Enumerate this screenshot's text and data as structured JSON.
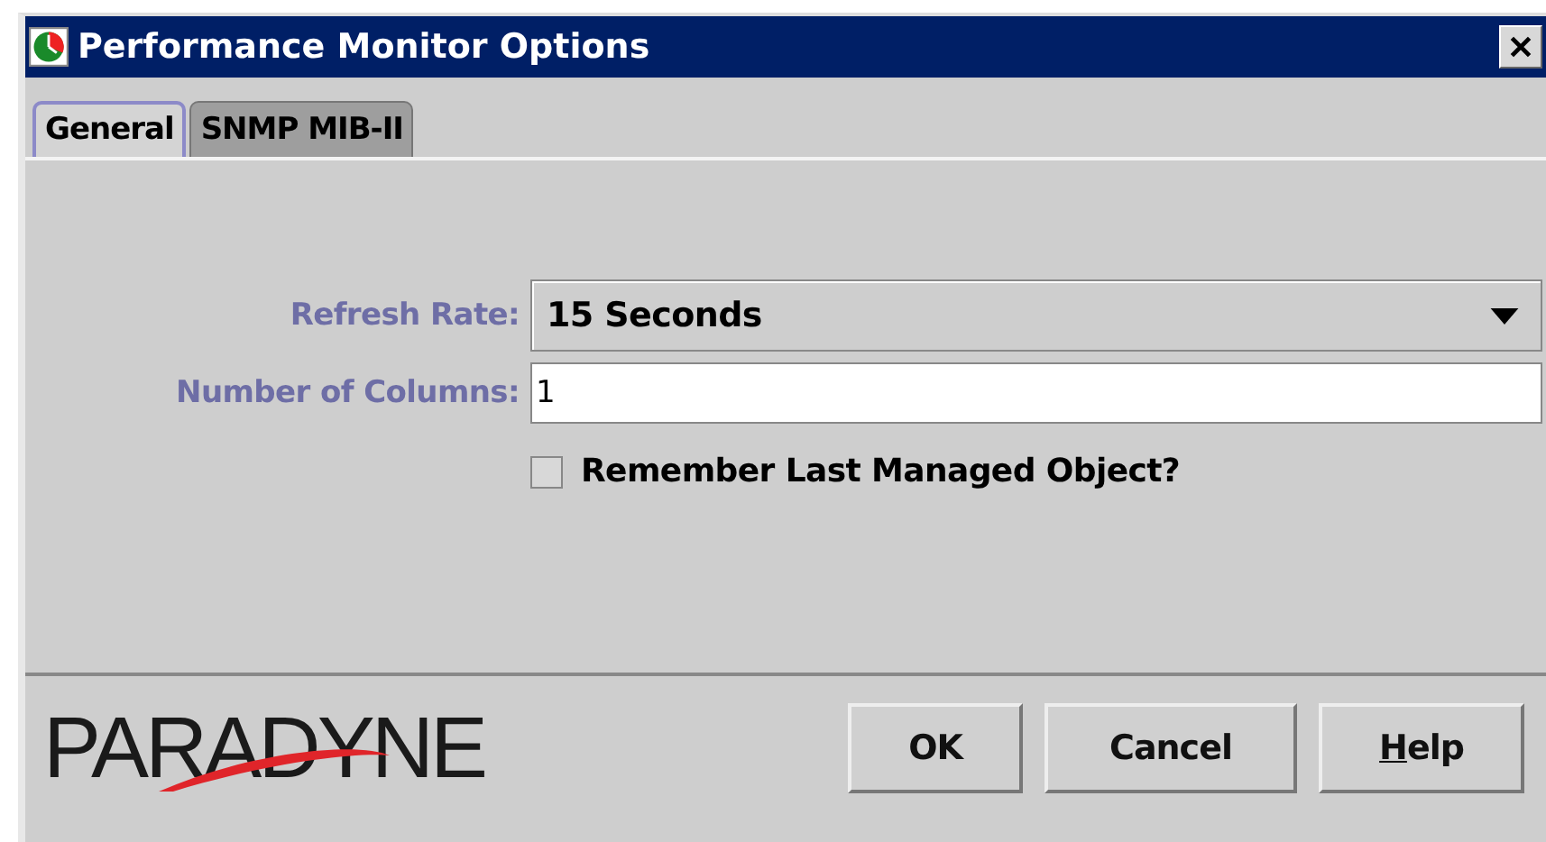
{
  "window": {
    "title": "Performance Monitor Options"
  },
  "tabs": [
    {
      "label": "General",
      "selected": true
    },
    {
      "label": "SNMP MIB-II",
      "selected": false
    }
  ],
  "form": {
    "refresh_rate": {
      "label": "Refresh Rate:",
      "value": "15 Seconds"
    },
    "columns": {
      "label": "Number of Columns:",
      "value": "1"
    },
    "remember": {
      "label": "Remember Last Managed Object?",
      "checked": false
    }
  },
  "logo": {
    "text": "PARADYNE"
  },
  "buttons": [
    {
      "label": "OK",
      "mnemonic_underlined": false
    },
    {
      "label": "Cancel",
      "mnemonic_underlined": false
    },
    {
      "label": "Help",
      "mnemonic_underlined": true
    }
  ]
}
